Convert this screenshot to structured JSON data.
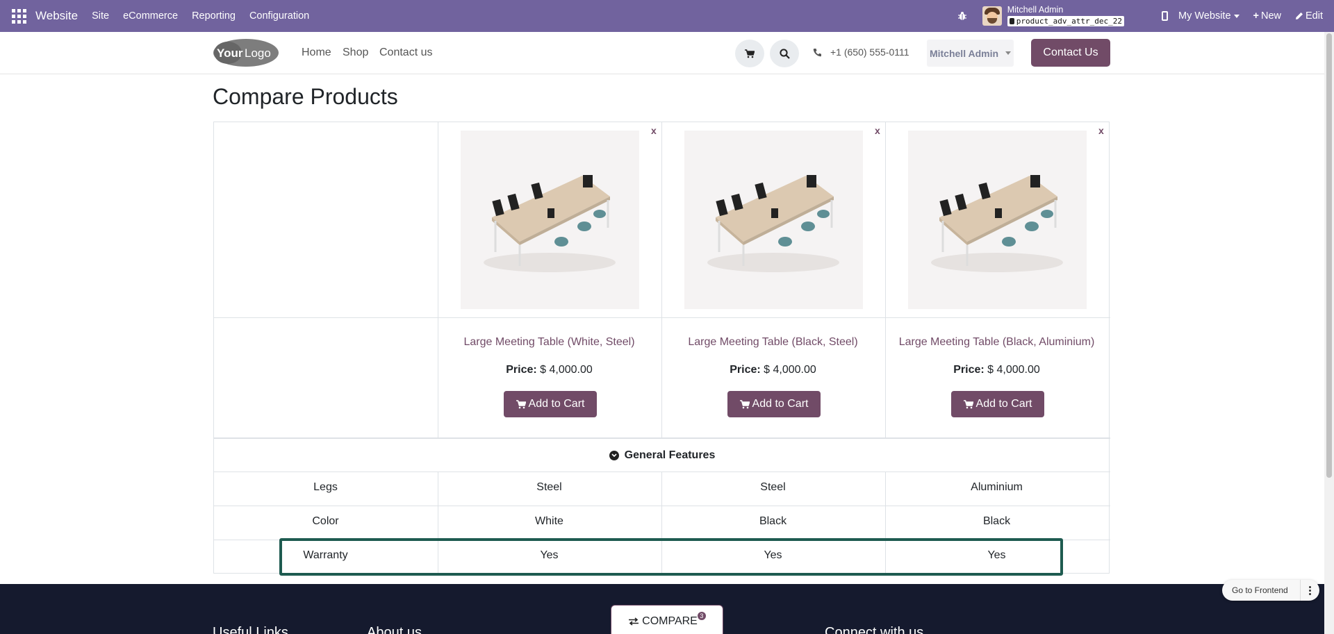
{
  "admin_bar": {
    "brand": "Website",
    "menu": [
      "Site",
      "eCommerce",
      "Reporting",
      "Configuration"
    ],
    "user_name": "Mitchell Admin",
    "database": "product_adv_attr_dec_22",
    "website_switch": "My Website",
    "new_label": "New",
    "edit_label": "Edit",
    "bg_color": "#71639e"
  },
  "header": {
    "logo_text": "YourLogo",
    "nav": [
      "Home",
      "Shop",
      "Contact us"
    ],
    "phone": "+1 (650) 555-0111",
    "user_dropdown": "Mitchell Admin",
    "contact_button": "Contact Us",
    "accent_color": "#714b67"
  },
  "page": {
    "title": "Compare Products"
  },
  "products": [
    {
      "name": "Large Meeting Table (White, Steel)",
      "price_label": "Price:",
      "price": "$ 4,000.00",
      "cart_label": "Add to Cart",
      "remove": "x"
    },
    {
      "name": "Large Meeting Table (Black, Steel)",
      "price_label": "Price:",
      "price": "$ 4,000.00",
      "cart_label": "Add to Cart",
      "remove": "x"
    },
    {
      "name": "Large Meeting Table (Black, Aluminium)",
      "price_label": "Price:",
      "price": "$ 4,000.00",
      "cart_label": "Add to Cart",
      "remove": "x"
    }
  ],
  "features": {
    "section_title": "General Features",
    "rows": [
      {
        "label": "Legs",
        "values": [
          "Steel",
          "Steel",
          "Aluminium"
        ]
      },
      {
        "label": "Color",
        "values": [
          "White",
          "Black",
          "Black"
        ]
      },
      {
        "label": "Warranty",
        "values": [
          "Yes",
          "Yes",
          "Yes"
        ]
      }
    ]
  },
  "footer": {
    "compare_label": "COMPARE",
    "compare_count": "3",
    "go_frontend": "Go to Frontend",
    "col1": "Useful Links",
    "col2": "About us",
    "col3": "Connect with us"
  }
}
